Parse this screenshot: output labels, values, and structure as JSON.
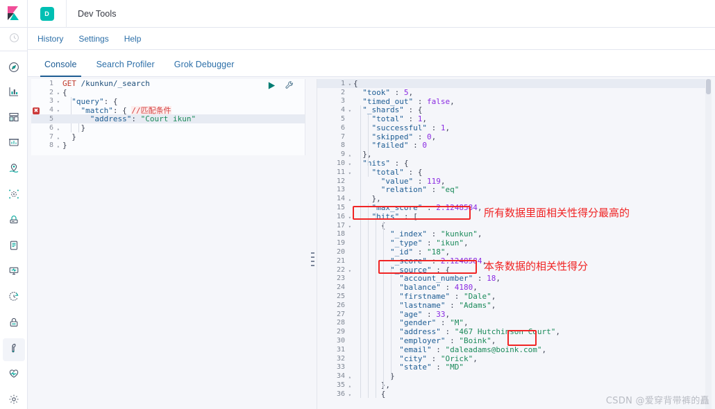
{
  "header": {
    "logo_name": "kibana-logo",
    "app_badge": "D",
    "title": "Dev Tools"
  },
  "sidebar": {
    "items": [
      {
        "icon": "recent-clock-icon",
        "name": "recently-viewed"
      },
      {
        "icon": "compass-discover-icon",
        "name": "discover"
      },
      {
        "icon": "bar-chart-visualize-icon",
        "name": "visualize"
      },
      {
        "icon": "dashboard-grid-icon",
        "name": "dashboard"
      },
      {
        "icon": "canvas-presentation-icon",
        "name": "canvas"
      },
      {
        "icon": "maps-pin-icon",
        "name": "maps"
      },
      {
        "icon": "machine-learning-icon",
        "name": "machine-learning"
      },
      {
        "icon": "infrastructure-icon",
        "name": "infrastructure"
      },
      {
        "icon": "logs-scroll-icon",
        "name": "logs"
      },
      {
        "icon": "apm-monitor-icon",
        "name": "apm"
      },
      {
        "icon": "uptime-clock-icon",
        "name": "uptime"
      },
      {
        "icon": "security-lock-icon",
        "name": "siem"
      },
      {
        "icon": "wrench-devtools-icon",
        "name": "dev-tools",
        "active": true
      },
      {
        "icon": "heartbeat-monitoring-icon",
        "name": "stack-monitoring"
      },
      {
        "icon": "gear-management-icon",
        "name": "management"
      }
    ]
  },
  "subnav": {
    "links": [
      "History",
      "Settings",
      "Help"
    ]
  },
  "tabs": [
    {
      "label": "Console",
      "active": true
    },
    {
      "label": "Search Profiler",
      "active": false
    },
    {
      "label": "Grok Debugger",
      "active": false
    }
  ],
  "editor": {
    "run_icon": "play-run-icon",
    "wrench_icon": "wrench-icon",
    "lines": [
      {
        "n": "1",
        "fold": "",
        "error": false,
        "hl": false,
        "tokens": [
          {
            "t": "GET ",
            "c": "tk-method"
          },
          {
            "t": "/kunkun/_search",
            "c": "tk-url"
          }
        ]
      },
      {
        "n": "2",
        "fold": "▾",
        "error": false,
        "hl": false,
        "tokens": [
          {
            "t": "{",
            "c": "tk-punc"
          }
        ]
      },
      {
        "n": "3",
        "fold": "▾",
        "error": false,
        "hl": false,
        "tokens": [
          {
            "t": "  ",
            "c": "tk-punc"
          },
          {
            "t": "\"query\"",
            "c": "tk-key"
          },
          {
            "t": ": {",
            "c": "tk-punc"
          }
        ]
      },
      {
        "n": "4",
        "fold": "▾",
        "error": true,
        "hl": false,
        "tokens": [
          {
            "t": "    ",
            "c": "tk-punc"
          },
          {
            "t": "\"match\"",
            "c": "tk-key"
          },
          {
            "t": ": { ",
            "c": "tk-punc"
          },
          {
            "t": "//匹配条件",
            "c": "tk-comment"
          }
        ]
      },
      {
        "n": "5",
        "fold": "",
        "error": false,
        "hl": true,
        "tokens": [
          {
            "t": "      ",
            "c": "tk-punc"
          },
          {
            "t": "\"address\"",
            "c": "tk-key"
          },
          {
            "t": ": ",
            "c": "tk-punc"
          },
          {
            "t": "\"Court ikun\"",
            "c": "tk-str"
          }
        ]
      },
      {
        "n": "6",
        "fold": "▴",
        "error": false,
        "hl": false,
        "tokens": [
          {
            "t": "    }",
            "c": "tk-punc"
          }
        ]
      },
      {
        "n": "7",
        "fold": "▴",
        "error": false,
        "hl": false,
        "tokens": [
          {
            "t": "  }",
            "c": "tk-punc"
          }
        ]
      },
      {
        "n": "8",
        "fold": "▴",
        "error": false,
        "hl": false,
        "tokens": [
          {
            "t": "}",
            "c": "tk-punc"
          }
        ]
      }
    ]
  },
  "output": {
    "lines": [
      {
        "n": "1",
        "fold": "▾",
        "hl": true,
        "tokens": [
          {
            "t": "{",
            "c": "tk-punc"
          }
        ]
      },
      {
        "n": "2",
        "fold": "",
        "hl": false,
        "tokens": [
          {
            "t": "  ",
            "c": "tk-punc"
          },
          {
            "t": "\"took\"",
            "c": "tk-key"
          },
          {
            "t": " : ",
            "c": "tk-punc"
          },
          {
            "t": "5",
            "c": "tk-num"
          },
          {
            "t": ",",
            "c": "tk-punc"
          }
        ]
      },
      {
        "n": "3",
        "fold": "",
        "hl": false,
        "tokens": [
          {
            "t": "  ",
            "c": "tk-punc"
          },
          {
            "t": "\"timed_out\"",
            "c": "tk-key"
          },
          {
            "t": " : ",
            "c": "tk-punc"
          },
          {
            "t": "false",
            "c": "tk-bool"
          },
          {
            "t": ",",
            "c": "tk-punc"
          }
        ]
      },
      {
        "n": "4",
        "fold": "▾",
        "hl": false,
        "tokens": [
          {
            "t": "  ",
            "c": "tk-punc"
          },
          {
            "t": "\"_shards\"",
            "c": "tk-key"
          },
          {
            "t": " : {",
            "c": "tk-punc"
          }
        ]
      },
      {
        "n": "5",
        "fold": "",
        "hl": false,
        "tokens": [
          {
            "t": "    ",
            "c": "tk-punc"
          },
          {
            "t": "\"total\"",
            "c": "tk-key"
          },
          {
            "t": " : ",
            "c": "tk-punc"
          },
          {
            "t": "1",
            "c": "tk-num"
          },
          {
            "t": ",",
            "c": "tk-punc"
          }
        ]
      },
      {
        "n": "6",
        "fold": "",
        "hl": false,
        "tokens": [
          {
            "t": "    ",
            "c": "tk-punc"
          },
          {
            "t": "\"successful\"",
            "c": "tk-key"
          },
          {
            "t": " : ",
            "c": "tk-punc"
          },
          {
            "t": "1",
            "c": "tk-num"
          },
          {
            "t": ",",
            "c": "tk-punc"
          }
        ]
      },
      {
        "n": "7",
        "fold": "",
        "hl": false,
        "tokens": [
          {
            "t": "    ",
            "c": "tk-punc"
          },
          {
            "t": "\"skipped\"",
            "c": "tk-key"
          },
          {
            "t": " : ",
            "c": "tk-punc"
          },
          {
            "t": "0",
            "c": "tk-num"
          },
          {
            "t": ",",
            "c": "tk-punc"
          }
        ]
      },
      {
        "n": "8",
        "fold": "",
        "hl": false,
        "tokens": [
          {
            "t": "    ",
            "c": "tk-punc"
          },
          {
            "t": "\"failed\"",
            "c": "tk-key"
          },
          {
            "t": " : ",
            "c": "tk-punc"
          },
          {
            "t": "0",
            "c": "tk-num"
          }
        ]
      },
      {
        "n": "9",
        "fold": "▴",
        "hl": false,
        "tokens": [
          {
            "t": "  },",
            "c": "tk-punc"
          }
        ]
      },
      {
        "n": "10",
        "fold": "▾",
        "hl": false,
        "tokens": [
          {
            "t": "  ",
            "c": "tk-punc"
          },
          {
            "t": "\"hits\"",
            "c": "tk-key"
          },
          {
            "t": " : {",
            "c": "tk-punc"
          }
        ]
      },
      {
        "n": "11",
        "fold": "▾",
        "hl": false,
        "tokens": [
          {
            "t": "    ",
            "c": "tk-punc"
          },
          {
            "t": "\"total\"",
            "c": "tk-key"
          },
          {
            "t": " : {",
            "c": "tk-punc"
          }
        ]
      },
      {
        "n": "12",
        "fold": "",
        "hl": false,
        "tokens": [
          {
            "t": "      ",
            "c": "tk-punc"
          },
          {
            "t": "\"value\"",
            "c": "tk-key"
          },
          {
            "t": " : ",
            "c": "tk-punc"
          },
          {
            "t": "119",
            "c": "tk-num"
          },
          {
            "t": ",",
            "c": "tk-punc"
          }
        ]
      },
      {
        "n": "13",
        "fold": "",
        "hl": false,
        "tokens": [
          {
            "t": "      ",
            "c": "tk-punc"
          },
          {
            "t": "\"relation\"",
            "c": "tk-key"
          },
          {
            "t": " : ",
            "c": "tk-punc"
          },
          {
            "t": "\"eq\"",
            "c": "tk-str"
          }
        ]
      },
      {
        "n": "14",
        "fold": "▴",
        "hl": false,
        "tokens": [
          {
            "t": "    },",
            "c": "tk-punc"
          }
        ]
      },
      {
        "n": "15",
        "fold": "",
        "hl": false,
        "tokens": [
          {
            "t": "    ",
            "c": "tk-punc"
          },
          {
            "t": "\"max_score\"",
            "c": "tk-key"
          },
          {
            "t": " : ",
            "c": "tk-punc"
          },
          {
            "t": "2.1248584",
            "c": "tk-num"
          },
          {
            "t": ",",
            "c": "tk-punc"
          }
        ]
      },
      {
        "n": "16",
        "fold": "▾",
        "hl": false,
        "tokens": [
          {
            "t": "    ",
            "c": "tk-punc"
          },
          {
            "t": "\"hits\"",
            "c": "tk-key"
          },
          {
            "t": " : [",
            "c": "tk-punc"
          }
        ]
      },
      {
        "n": "17",
        "fold": "▾",
        "hl": false,
        "tokens": [
          {
            "t": "      {",
            "c": "tk-punc"
          }
        ]
      },
      {
        "n": "18",
        "fold": "",
        "hl": false,
        "tokens": [
          {
            "t": "        ",
            "c": "tk-punc"
          },
          {
            "t": "\"_index\"",
            "c": "tk-key"
          },
          {
            "t": " : ",
            "c": "tk-punc"
          },
          {
            "t": "\"kunkun\"",
            "c": "tk-str"
          },
          {
            "t": ",",
            "c": "tk-punc"
          }
        ]
      },
      {
        "n": "19",
        "fold": "",
        "hl": false,
        "tokens": [
          {
            "t": "        ",
            "c": "tk-punc"
          },
          {
            "t": "\"_type\"",
            "c": "tk-key"
          },
          {
            "t": " : ",
            "c": "tk-punc"
          },
          {
            "t": "\"ikun\"",
            "c": "tk-str"
          },
          {
            "t": ",",
            "c": "tk-punc"
          }
        ]
      },
      {
        "n": "20",
        "fold": "",
        "hl": false,
        "tokens": [
          {
            "t": "        ",
            "c": "tk-punc"
          },
          {
            "t": "\"_id\"",
            "c": "tk-key"
          },
          {
            "t": " : ",
            "c": "tk-punc"
          },
          {
            "t": "\"18\"",
            "c": "tk-str"
          },
          {
            "t": ",",
            "c": "tk-punc"
          }
        ]
      },
      {
        "n": "21",
        "fold": "",
        "hl": false,
        "tokens": [
          {
            "t": "        ",
            "c": "tk-punc"
          },
          {
            "t": "\"_score\"",
            "c": "tk-key"
          },
          {
            "t": " : ",
            "c": "tk-punc"
          },
          {
            "t": "2.1248584",
            "c": "tk-num"
          },
          {
            "t": ",",
            "c": "tk-punc"
          }
        ]
      },
      {
        "n": "22",
        "fold": "▾",
        "hl": false,
        "tokens": [
          {
            "t": "        ",
            "c": "tk-punc"
          },
          {
            "t": "\"_source\"",
            "c": "tk-key"
          },
          {
            "t": " : {",
            "c": "tk-punc"
          }
        ]
      },
      {
        "n": "23",
        "fold": "",
        "hl": false,
        "tokens": [
          {
            "t": "          ",
            "c": "tk-punc"
          },
          {
            "t": "\"account_number\"",
            "c": "tk-key"
          },
          {
            "t": " : ",
            "c": "tk-punc"
          },
          {
            "t": "18",
            "c": "tk-num"
          },
          {
            "t": ",",
            "c": "tk-punc"
          }
        ]
      },
      {
        "n": "24",
        "fold": "",
        "hl": false,
        "tokens": [
          {
            "t": "          ",
            "c": "tk-punc"
          },
          {
            "t": "\"balance\"",
            "c": "tk-key"
          },
          {
            "t": " : ",
            "c": "tk-punc"
          },
          {
            "t": "4180",
            "c": "tk-num"
          },
          {
            "t": ",",
            "c": "tk-punc"
          }
        ]
      },
      {
        "n": "25",
        "fold": "",
        "hl": false,
        "tokens": [
          {
            "t": "          ",
            "c": "tk-punc"
          },
          {
            "t": "\"firstname\"",
            "c": "tk-key"
          },
          {
            "t": " : ",
            "c": "tk-punc"
          },
          {
            "t": "\"Dale\"",
            "c": "tk-str"
          },
          {
            "t": ",",
            "c": "tk-punc"
          }
        ]
      },
      {
        "n": "26",
        "fold": "",
        "hl": false,
        "tokens": [
          {
            "t": "          ",
            "c": "tk-punc"
          },
          {
            "t": "\"lastname\"",
            "c": "tk-key"
          },
          {
            "t": " : ",
            "c": "tk-punc"
          },
          {
            "t": "\"Adams\"",
            "c": "tk-str"
          },
          {
            "t": ",",
            "c": "tk-punc"
          }
        ]
      },
      {
        "n": "27",
        "fold": "",
        "hl": false,
        "tokens": [
          {
            "t": "          ",
            "c": "tk-punc"
          },
          {
            "t": "\"age\"",
            "c": "tk-key"
          },
          {
            "t": " : ",
            "c": "tk-punc"
          },
          {
            "t": "33",
            "c": "tk-num"
          },
          {
            "t": ",",
            "c": "tk-punc"
          }
        ]
      },
      {
        "n": "28",
        "fold": "",
        "hl": false,
        "tokens": [
          {
            "t": "          ",
            "c": "tk-punc"
          },
          {
            "t": "\"gender\"",
            "c": "tk-key"
          },
          {
            "t": " : ",
            "c": "tk-punc"
          },
          {
            "t": "\"M\"",
            "c": "tk-str"
          },
          {
            "t": ",",
            "c": "tk-punc"
          }
        ]
      },
      {
        "n": "29",
        "fold": "",
        "hl": false,
        "tokens": [
          {
            "t": "          ",
            "c": "tk-punc"
          },
          {
            "t": "\"address\"",
            "c": "tk-key"
          },
          {
            "t": " : ",
            "c": "tk-punc"
          },
          {
            "t": "\"467 Hutchinson Court\"",
            "c": "tk-str"
          },
          {
            "t": ",",
            "c": "tk-punc"
          }
        ]
      },
      {
        "n": "30",
        "fold": "",
        "hl": false,
        "tokens": [
          {
            "t": "          ",
            "c": "tk-punc"
          },
          {
            "t": "\"employer\"",
            "c": "tk-key"
          },
          {
            "t": " : ",
            "c": "tk-punc"
          },
          {
            "t": "\"Boink\"",
            "c": "tk-str"
          },
          {
            "t": ",",
            "c": "tk-punc"
          }
        ]
      },
      {
        "n": "31",
        "fold": "",
        "hl": false,
        "tokens": [
          {
            "t": "          ",
            "c": "tk-punc"
          },
          {
            "t": "\"email\"",
            "c": "tk-key"
          },
          {
            "t": " : ",
            "c": "tk-punc"
          },
          {
            "t": "\"daleadams@boink.com\"",
            "c": "tk-str"
          },
          {
            "t": ",",
            "c": "tk-punc"
          }
        ]
      },
      {
        "n": "32",
        "fold": "",
        "hl": false,
        "tokens": [
          {
            "t": "          ",
            "c": "tk-punc"
          },
          {
            "t": "\"city\"",
            "c": "tk-key"
          },
          {
            "t": " : ",
            "c": "tk-punc"
          },
          {
            "t": "\"Orick\"",
            "c": "tk-str"
          },
          {
            "t": ",",
            "c": "tk-punc"
          }
        ]
      },
      {
        "n": "33",
        "fold": "",
        "hl": false,
        "tokens": [
          {
            "t": "          ",
            "c": "tk-punc"
          },
          {
            "t": "\"state\"",
            "c": "tk-key"
          },
          {
            "t": " : ",
            "c": "tk-punc"
          },
          {
            "t": "\"MD\"",
            "c": "tk-str"
          }
        ]
      },
      {
        "n": "34",
        "fold": "▴",
        "hl": false,
        "tokens": [
          {
            "t": "        }",
            "c": "tk-punc"
          }
        ]
      },
      {
        "n": "35",
        "fold": "▴",
        "hl": false,
        "tokens": [
          {
            "t": "      },",
            "c": "tk-punc"
          }
        ]
      },
      {
        "n": "36",
        "fold": "▾",
        "hl": false,
        "tokens": [
          {
            "t": "      {",
            "c": "tk-punc"
          }
        ]
      }
    ]
  },
  "annotations": {
    "color": "#f02424",
    "note_max_score": "所有数据里面相关性得分最高的",
    "note_doc_score": "本条数据的相关性得分",
    "boxes": [
      "max-score-highlight-box",
      "score-highlight-box",
      "court-highlight-box"
    ]
  },
  "watermark": "CSDN @爱穿背带裤的矗"
}
